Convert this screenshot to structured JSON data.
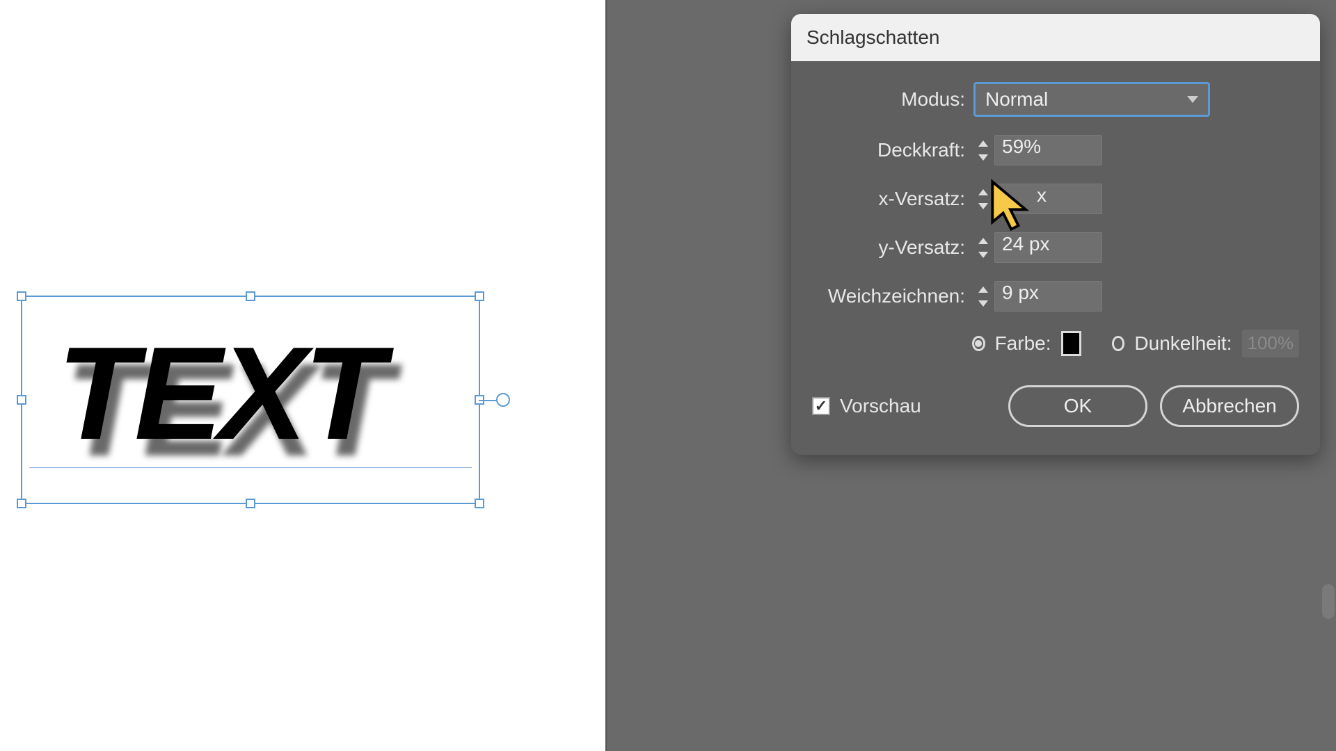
{
  "canvas": {
    "text": "TEXT"
  },
  "dialog": {
    "title": "Schlagschatten",
    "mode_label": "Modus:",
    "mode_value": "Normal",
    "opacity_label": "Deckkraft:",
    "opacity_value": "59%",
    "xoffset_label": "x-Versatz:",
    "xoffset_value": "x",
    "yoffset_label": "y-Versatz:",
    "yoffset_value": "24 px",
    "blur_label": "Weichzeichnen:",
    "blur_value": "9 px",
    "color_label": "Farbe:",
    "color_value": "#000000",
    "darkness_label": "Dunkelheit:",
    "darkness_value": "100%",
    "preview_label": "Vorschau",
    "ok_label": "OK",
    "cancel_label": "Abbrechen"
  }
}
